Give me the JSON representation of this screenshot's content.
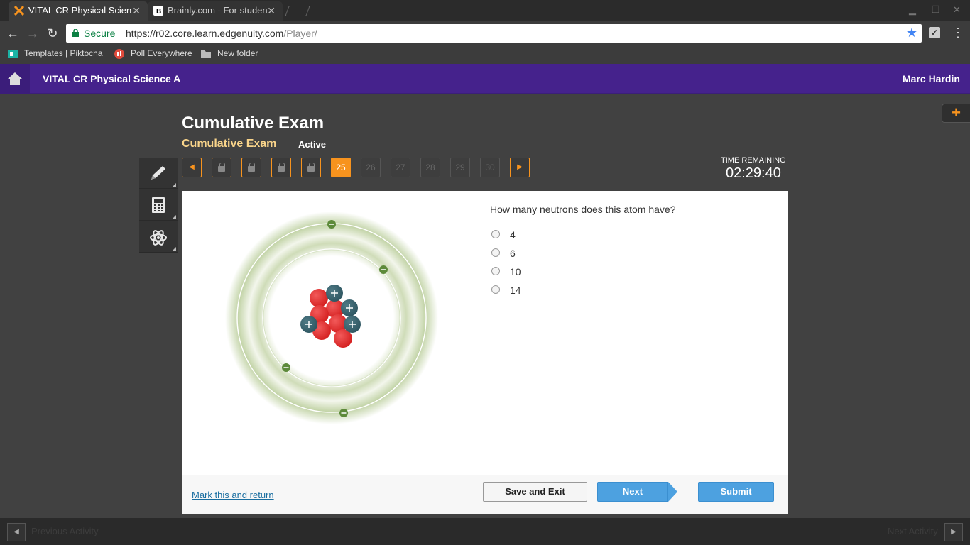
{
  "browser": {
    "tabs": [
      {
        "title": "VITAL CR Physical Scien",
        "favicon": "edgenuity-x-icon"
      },
      {
        "title": "Brainly.com - For studen",
        "favicon": "brainly-b-icon"
      }
    ],
    "secure_label": "Secure",
    "url_host": "https://r02.core.learn.edgenuity.com",
    "url_path": "/Player/",
    "bookmarks": [
      {
        "label": "Templates | Piktocha"
      },
      {
        "label": "Poll Everywhere"
      },
      {
        "label": "New folder"
      }
    ]
  },
  "app": {
    "course_title": "VITAL CR Physical Science A",
    "user_name": "Marc Hardin",
    "brand_color": "#45228c",
    "accent_color": "#f7931e"
  },
  "exam": {
    "title": "Cumulative Exam",
    "subtitle": "Cumulative Exam",
    "status": "Active",
    "current_question": "25",
    "future_questions": [
      "26",
      "27",
      "28",
      "29",
      "30"
    ],
    "time_label": "TIME REMAINING",
    "time_value": "02:29:40"
  },
  "tools": [
    "pencil-icon",
    "calculator-icon",
    "atom-icon"
  ],
  "question": {
    "text": "How many neutrons does this atom have?",
    "options": [
      "4",
      "6",
      "10",
      "14"
    ]
  },
  "footer": {
    "mark_link": "Mark this and return",
    "save_exit": "Save and Exit",
    "next": "Next",
    "submit": "Submit"
  },
  "bottom": {
    "previous": "Previous Activity",
    "next": "Next Activity"
  }
}
